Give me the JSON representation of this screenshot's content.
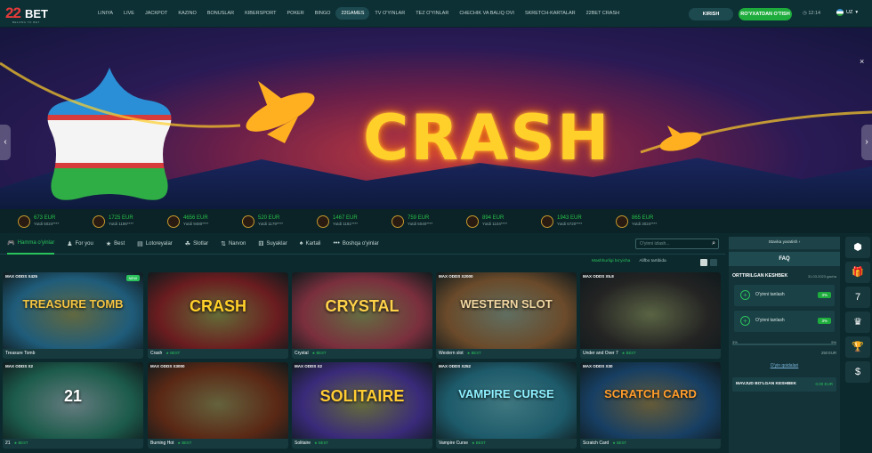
{
  "header": {
    "logo_num": "22",
    "logo_bet": "BET",
    "logo_tag": "BELONG TO BET",
    "nav": [
      "LINIYA",
      "LIVE",
      "JACKPOT",
      "KAZINO",
      "BONUSLAR",
      "KIBERSPORT",
      "POKER",
      "BINGO",
      "22GAMES",
      "TV O'YINLAR",
      "TEZ O'YINLAR",
      "CHECHIK VA BALIQ OVI",
      "SKRETCH-KARTALAR",
      "22BET CRASH"
    ],
    "active_nav": 8,
    "login_label": "KIRISH",
    "register_label": "RO'YXATDAN O'TISH",
    "time": "12:14",
    "lang": "UZ"
  },
  "banner": {
    "title": "CRASH",
    "prev_icon": "chevron-left-icon",
    "next_icon": "chevron-right-icon",
    "slides": 9,
    "active_slide": 5
  },
  "winners": [
    {
      "amount": "673 EUR",
      "user": "Yutdi 5024****"
    },
    {
      "amount": "1725 EUR",
      "user": "Yutdi 1186****"
    },
    {
      "amount": "4656 EUR",
      "user": "Yutdi 9480****"
    },
    {
      "amount": "520 EUR",
      "user": "Yutdi 1179****"
    },
    {
      "amount": "1467 EUR",
      "user": "Yutdi 1181****"
    },
    {
      "amount": "759 EUR",
      "user": "Yutdi 5040****"
    },
    {
      "amount": "894 EUR",
      "user": "Yutdi 1104****"
    },
    {
      "amount": "1943 EUR",
      "user": "Yutdi 6720****"
    },
    {
      "amount": "865 EUR",
      "user": "Yutdi 3024****"
    }
  ],
  "tabs": [
    {
      "label": "Hamma o'yinlar",
      "icon": "gamepad-icon"
    },
    {
      "label": "For you",
      "icon": "user-icon"
    },
    {
      "label": "Best",
      "icon": "star-icon"
    },
    {
      "label": "Lotoreyalar",
      "icon": "ticket-icon"
    },
    {
      "label": "Slotlar",
      "icon": "slot-icon"
    },
    {
      "label": "Narvon",
      "icon": "ladder-icon"
    },
    {
      "label": "Suyaklar",
      "icon": "dice-icon"
    },
    {
      "label": "Kartali",
      "icon": "cards-icon"
    },
    {
      "label": "Boshqa o'yinlar",
      "icon": "more-icon"
    }
  ],
  "search": {
    "placeholder": "O'yinni izlash..."
  },
  "filters": {
    "popular": "Mashhurligi bo'yicha",
    "alpha": "Alifbo tartibida"
  },
  "games": [
    {
      "name": "Treasure Tomb",
      "odds": "MAX ODDS X425",
      "best": "",
      "art": "TREASURE TOMB",
      "is_new": true,
      "new_label": "NEW",
      "bg": "#1f5c7a",
      "fg": "#f5c542"
    },
    {
      "name": "Crash",
      "odds": "",
      "best": "BEST",
      "art": "CRASH",
      "is_new": false,
      "new_label": "",
      "bg": "#6a1c1f",
      "fg": "#ffcf2a"
    },
    {
      "name": "Crystal",
      "odds": "",
      "best": "BEST",
      "art": "CRYSTAL",
      "is_new": false,
      "new_label": "",
      "bg": "#7a2f3d",
      "fg": "#ffd24a"
    },
    {
      "name": "Western slot",
      "odds": "MAX ODDS X2000",
      "best": "BEST",
      "art": "WESTERN SLOT",
      "is_new": false,
      "new_label": "",
      "bg": "#6a4a2a",
      "fg": "#f2d7a2"
    },
    {
      "name": "Under and Over 7",
      "odds": "MAX ODDS X5.8",
      "best": "BEST",
      "art": "",
      "is_new": false,
      "new_label": "",
      "bg": "#232323",
      "fg": "#e0b74c"
    },
    {
      "name": "21",
      "odds": "MAX ODDS X2",
      "best": "BEST",
      "art": "21",
      "is_new": false,
      "new_label": "",
      "bg": "#1c5b4b",
      "fg": "#ffffff"
    },
    {
      "name": "Burning Hot",
      "odds": "MAX ODDS X3000",
      "best": "BEST",
      "art": "",
      "is_new": false,
      "new_label": "",
      "bg": "#5a2815",
      "fg": "#ffb33a"
    },
    {
      "name": "Solitaire",
      "odds": "MAX ODDS X2",
      "best": "BEST",
      "art": "SOLITAIRE",
      "is_new": false,
      "new_label": "",
      "bg": "#3a2a7a",
      "fg": "#ffcc33"
    },
    {
      "name": "Vampire Curse",
      "odds": "MAX ODDS X252",
      "best": "BEST",
      "art": "VAMPIRE CURSE",
      "is_new": false,
      "new_label": "",
      "bg": "#1d5a6a",
      "fg": "#8ff0ff"
    },
    {
      "name": "Scratch Card",
      "odds": "MAX ODDS X30",
      "best": "BEST",
      "art": "SCRATCH CARD",
      "is_new": false,
      "new_label": "",
      "bg": "#173f63",
      "fg": "#ff9c2b"
    }
  ],
  "betslip": {
    "tab_label": "Stavka yaratish",
    "faq": "FAQ",
    "title": "ORTTIRILGAN KESHBEK",
    "date": "31.03.2023 gacha",
    "picks": [
      {
        "label": "O'yinni tanlash",
        "odd": "3%"
      },
      {
        "label": "O'yinni tanlash",
        "odd": "3%"
      }
    ],
    "min": "3%",
    "max": "5%",
    "stake": "250 EUR",
    "rules": "O'yin qoidalari",
    "balance_label": "MAVJUD BO'LGAN KESHBEK",
    "balance_value": "0.00 EUR"
  },
  "side_icons": [
    {
      "icon": "casino-chip-icon",
      "glyph": "⬢"
    },
    {
      "icon": "gift-icon",
      "glyph": "🎁"
    },
    {
      "icon": "seven-icon",
      "glyph": "7"
    },
    {
      "icon": "award-icon",
      "glyph": "♛"
    },
    {
      "icon": "trophy-icon",
      "glyph": "🏆"
    },
    {
      "icon": "dollar-icon",
      "glyph": "$"
    }
  ]
}
